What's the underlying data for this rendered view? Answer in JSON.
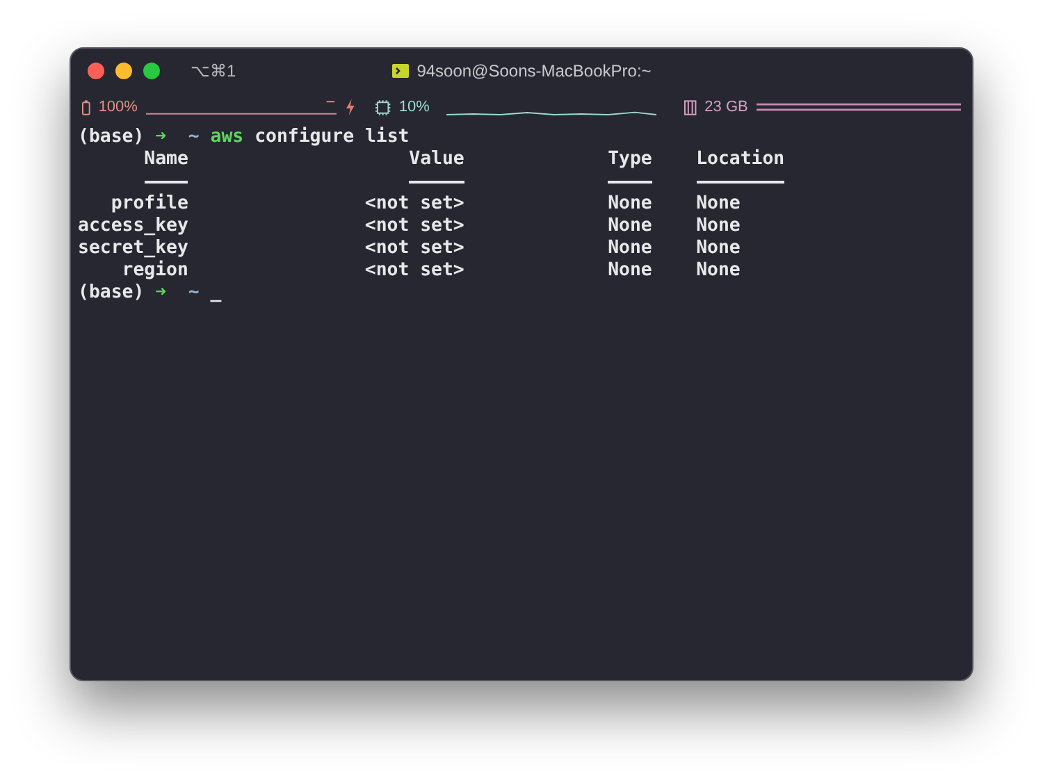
{
  "window": {
    "shortcut": "⌥⌘1",
    "title": "94soon@Soons-MacBookPro:~"
  },
  "status_bar": {
    "battery": {
      "reading": "100%",
      "charging": true
    },
    "cpu": {
      "reading": "10%"
    },
    "memory": {
      "reading": "23 GB"
    }
  },
  "command": {
    "env": "(base)",
    "arrow": "➜",
    "dir": "~",
    "program": "aws",
    "args": "configure list"
  },
  "table": {
    "columns": [
      "Name",
      "Value",
      "Type",
      "Location"
    ],
    "rows": [
      [
        "profile",
        "<not set>",
        "None",
        "None"
      ],
      [
        "access_key",
        "<not set>",
        "None",
        "None"
      ],
      [
        "secret_key",
        "<not set>",
        "None",
        "None"
      ],
      [
        "region",
        "<not set>",
        "None",
        "None"
      ]
    ]
  },
  "prompt": {
    "env": "(base)",
    "arrow": "➜",
    "dir": "~",
    "cursor": "_"
  }
}
